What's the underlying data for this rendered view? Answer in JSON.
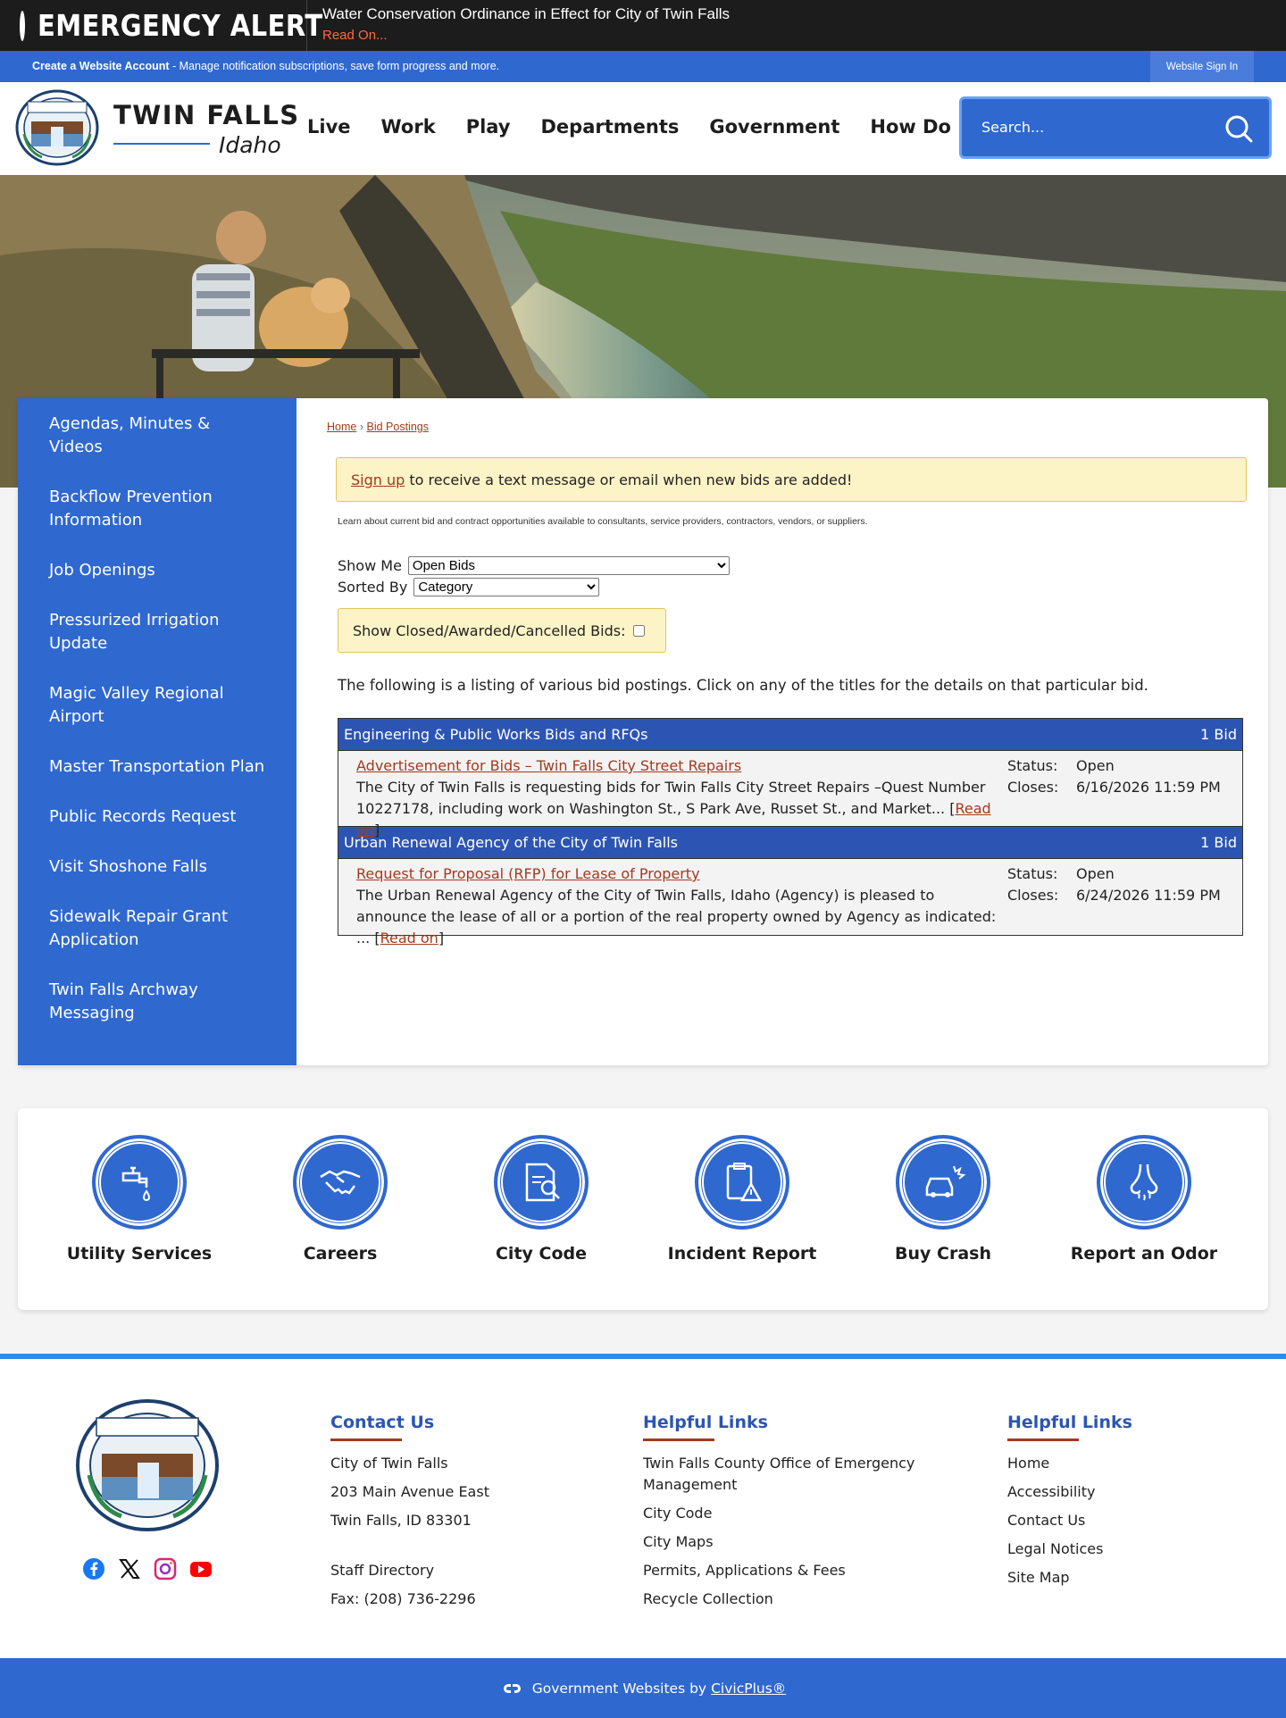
{
  "alert": {
    "title": "EMERGENCY ALERT",
    "message": "Water Conservation Ordinance in Effect for City of Twin Falls",
    "read_on": "Read On..."
  },
  "account_bar": {
    "create_link": "Create a Website Account",
    "description": " - Manage notification subscriptions, save form progress and more.",
    "sign_in": "Website Sign In"
  },
  "header": {
    "brand_name": "TWIN FALLS",
    "brand_state": "Idaho",
    "nav": [
      "Live",
      "Work",
      "Play",
      "Departments",
      "Government",
      "How Do I?"
    ],
    "search_placeholder": "Search..."
  },
  "sidebar": {
    "items": [
      "Agendas, Minutes & Videos",
      "Backflow Prevention Information",
      "Job Openings",
      "Pressurized Irrigation Update",
      "Magic Valley Regional Airport",
      "Master Transportation Plan",
      "Public Records Request",
      "Visit Shoshone Falls",
      "Sidewalk Repair Grant Application",
      "Twin Falls Archway Messaging"
    ]
  },
  "content": {
    "breadcrumb": {
      "home": "Home",
      "sep": "›",
      "current": "Bid Postings"
    },
    "notice": {
      "link": "Sign up",
      "text": " to receive a text message or email when new bids are added!"
    },
    "description": "Learn about current bid and contract opportunities available to consultants, service providers, contractors, vendors, or suppliers.",
    "show_me": {
      "label": "Show Me",
      "value": "Open Bids"
    },
    "sorted_by": {
      "label": "Sorted By",
      "value": "Category"
    },
    "closed_label": "Show Closed/Awarded/Cancelled Bids:",
    "listing_intro": "The following is a listing of various bid postings. Click on any of the titles for the details on that particular bid.",
    "categories": [
      {
        "name": "Engineering & Public Works Bids and RFQs",
        "count": "1 Bid",
        "bid": {
          "title": "Advertisement for Bids – Twin Falls City Street Repairs",
          "summary": "The City of Twin Falls is requesting bids for Twin Falls City Street Repairs –Quest Number 10227178, including work on Washington St., S Park Ave, Russet St., and Market... [",
          "read_on": "Read on",
          "close_bracket": "]",
          "status_label": "Status:",
          "status": "Open",
          "closes_label": "Closes:",
          "closes": "6/16/2026 11:59 PM"
        }
      },
      {
        "name": "Urban Renewal Agency of the City of Twin Falls",
        "count": "1 Bid",
        "bid": {
          "title": "Request for Proposal (RFP) for Lease of Property",
          "summary": "The Urban Renewal Agency of the City of Twin Falls, Idaho (Agency) is pleased to announce the lease of all or a portion of the real property owned by Agency as indicated: ... [",
          "read_on": "Read on",
          "close_bracket": "]",
          "status_label": "Status:",
          "status": "Open",
          "closes_label": "Closes:",
          "closes": "6/24/2026 11:59 PM"
        }
      }
    ]
  },
  "quick_links": [
    {
      "label": "Utility Services",
      "icon": "faucet-icon"
    },
    {
      "label": "Careers",
      "icon": "handshake-icon"
    },
    {
      "label": "City Code",
      "icon": "document-search-icon"
    },
    {
      "label": "Incident Report",
      "icon": "clipboard-warning-icon"
    },
    {
      "label": "Buy Crash",
      "icon": "car-crash-icon"
    },
    {
      "label": "Report an Odor",
      "icon": "nose-icon"
    }
  ],
  "footer": {
    "contact": {
      "heading": "Contact Us",
      "lines": [
        "City of Twin Falls",
        "203 Main Avenue East",
        "Twin Falls, ID 83301"
      ],
      "staff": "Staff Directory",
      "fax": "Fax: (208) 736-2296"
    },
    "helpful1": {
      "heading": "Helpful Links",
      "links": [
        "Twin Falls County Office of Emergency Management",
        "City Code",
        "City Maps",
        "Permits, Applications & Fees",
        "Recycle Collection"
      ]
    },
    "helpful2": {
      "heading": "Helpful Links",
      "links": [
        "Home",
        "Accessibility",
        "Contact Us",
        "Legal Notices",
        "Site Map"
      ]
    },
    "social": [
      "facebook-icon",
      "x-icon",
      "instagram-icon",
      "youtube-icon"
    ],
    "credit_text": "Government Websites by",
    "credit_link": "CivicPlus®"
  },
  "colors": {
    "primary_blue": "#2f68cf",
    "category_blue": "#2c55b3",
    "link_red": "#a33a1e",
    "notice_yellow": "#fcf3c6",
    "alert_bg": "#1c1c1c"
  }
}
